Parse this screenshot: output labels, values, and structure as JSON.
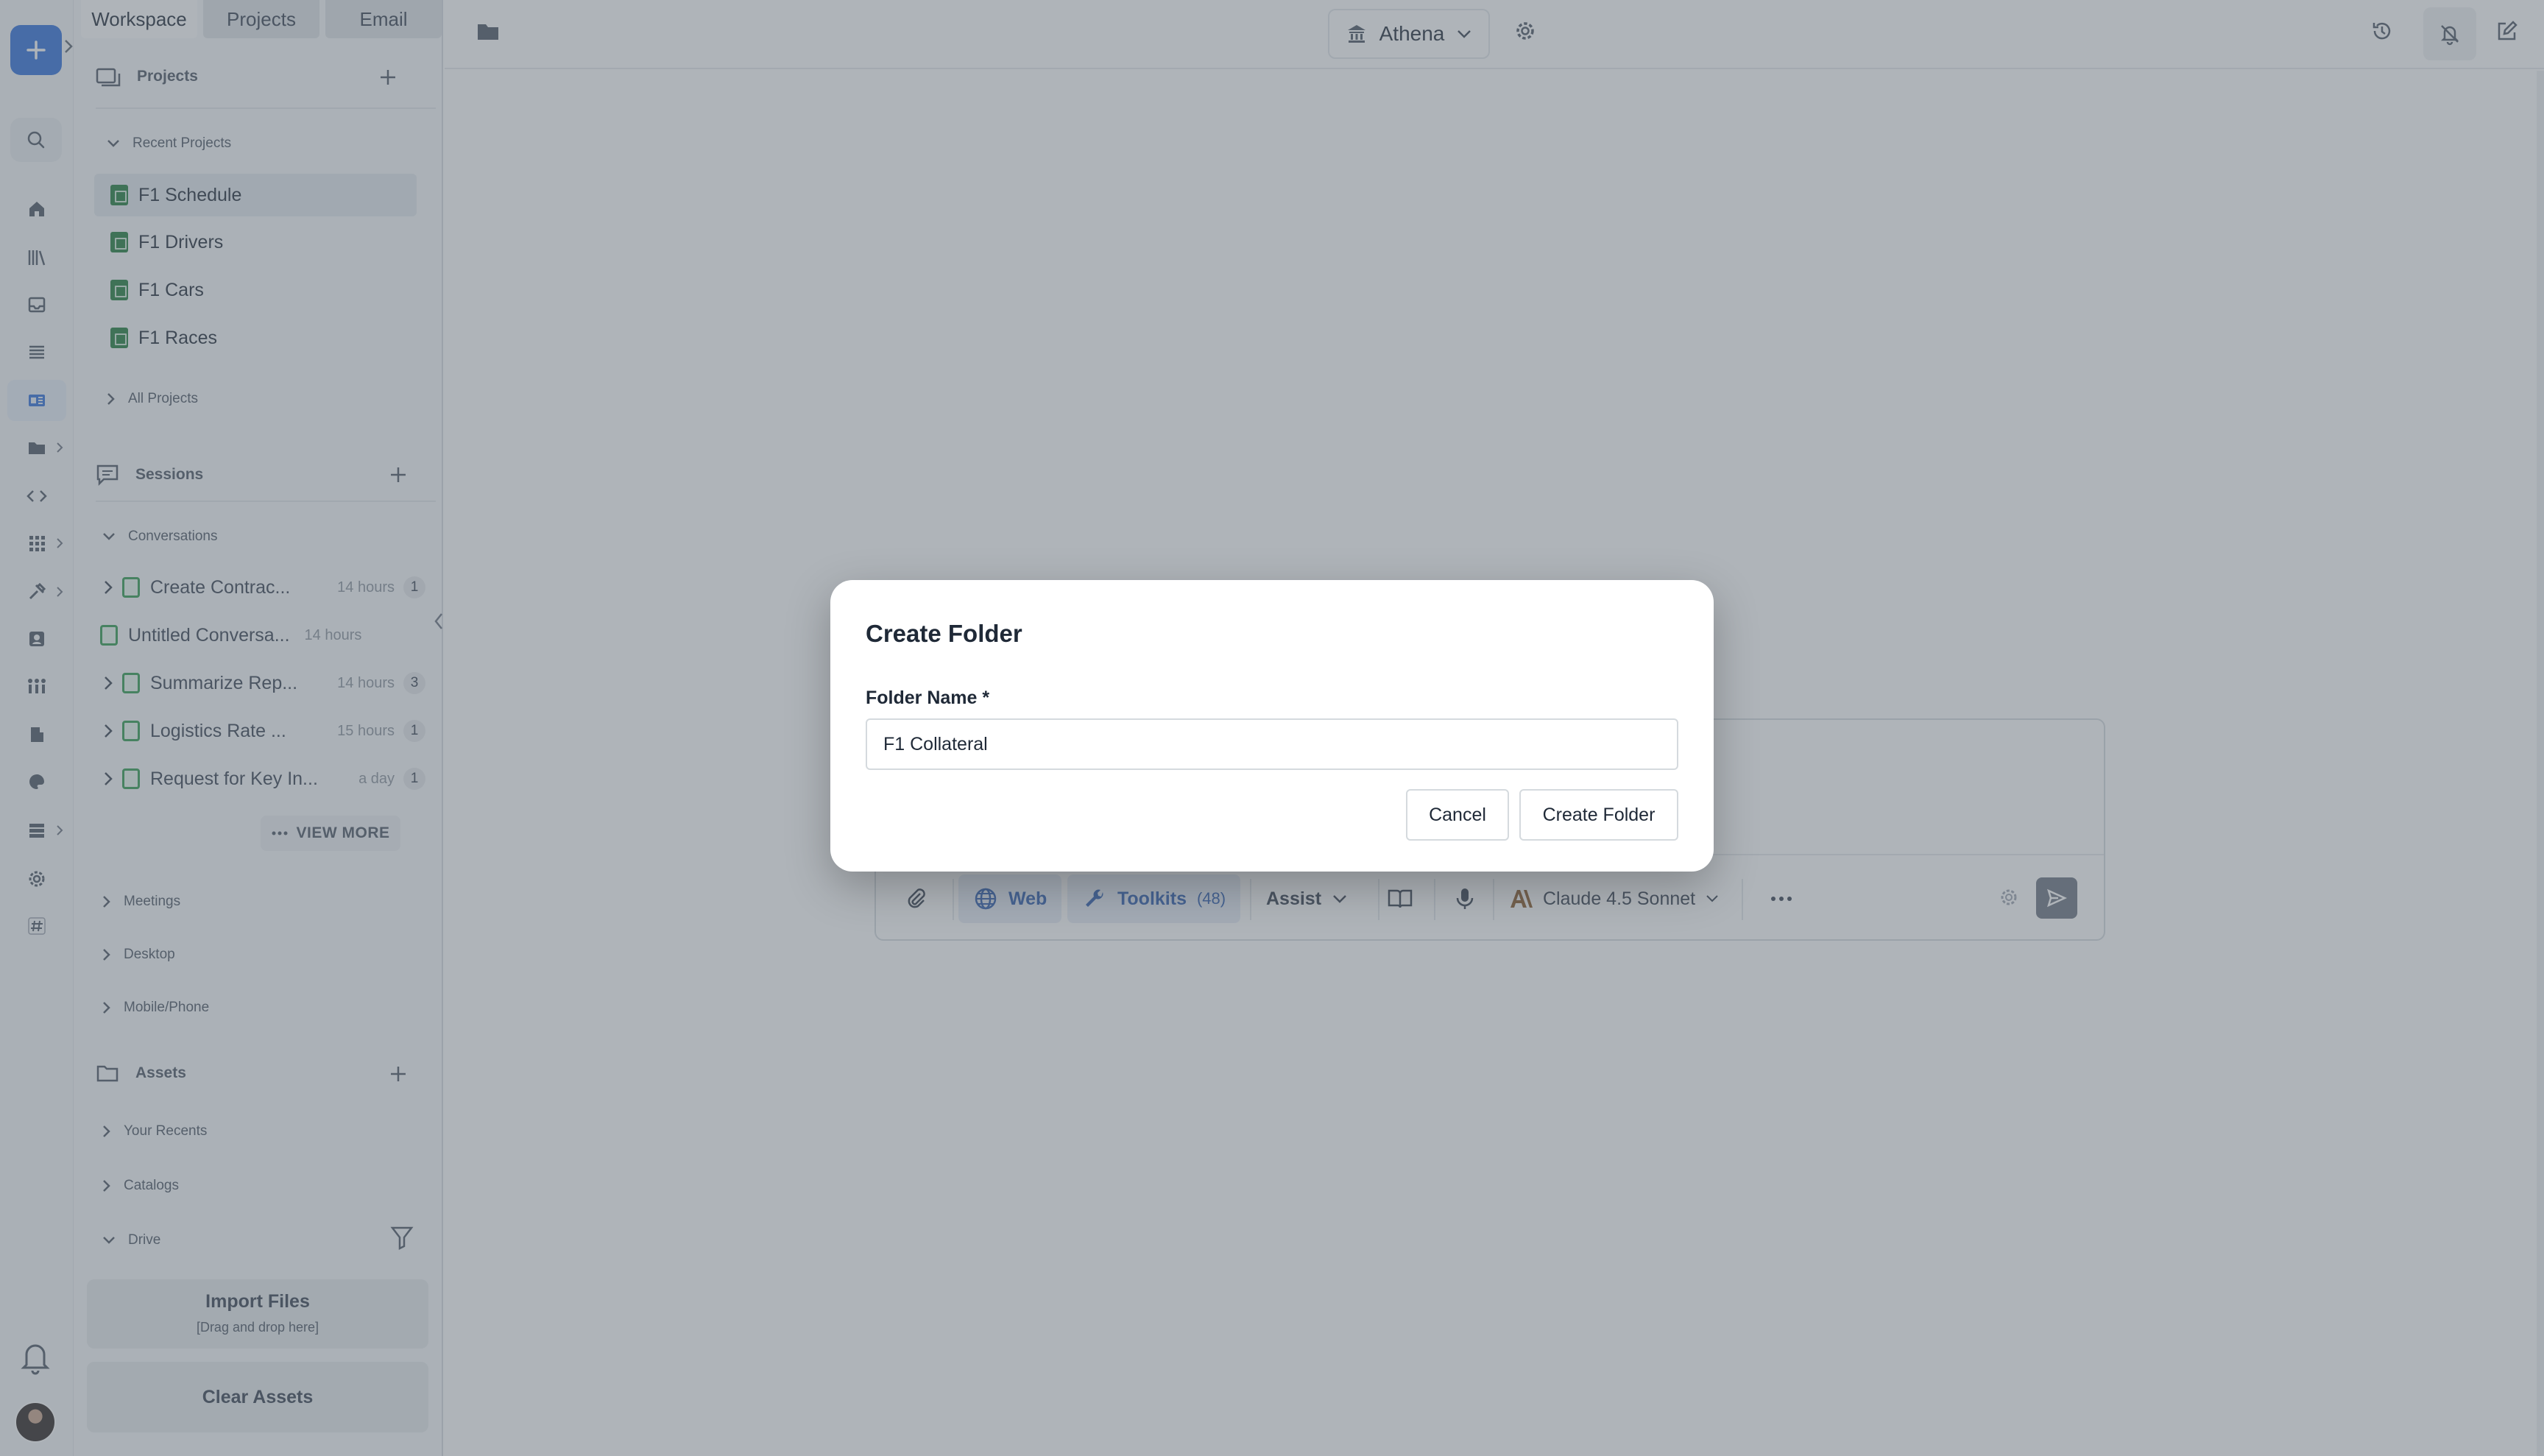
{
  "sidebar": {
    "tabs": [
      {
        "label": "Workspace"
      },
      {
        "label": "Projects"
      },
      {
        "label": "Email"
      }
    ],
    "projects": {
      "heading": "Projects",
      "recent_label": "Recent Projects",
      "items": [
        {
          "label": "F1 Schedule"
        },
        {
          "label": "F1 Drivers"
        },
        {
          "label": "F1 Cars"
        },
        {
          "label": "F1 Races"
        }
      ],
      "all_label": "All Projects"
    },
    "sessions": {
      "heading": "Sessions",
      "conversations_label": "Conversations",
      "items": [
        {
          "title": "Create Contrac...",
          "time": "14 hours",
          "count": "1"
        },
        {
          "title": "Untitled Conversa...",
          "time": "14 hours",
          "count": ""
        },
        {
          "title": "Summarize Rep...",
          "time": "14 hours",
          "count": "3"
        },
        {
          "title": "Logistics Rate ...",
          "time": "15 hours",
          "count": "1"
        },
        {
          "title": "Request for Key In...",
          "time": "a day",
          "count": "1"
        }
      ],
      "view_more": "VIEW MORE",
      "groups": [
        "Meetings",
        "Desktop",
        "Mobile/Phone"
      ]
    },
    "assets": {
      "heading": "Assets",
      "groups": [
        "Your Recents",
        "Catalogs",
        "Drive"
      ],
      "import_title": "Import Files",
      "import_sub": "[Drag and drop here]",
      "clear_label": "Clear Assets"
    }
  },
  "topbar": {
    "workspace": "Athena"
  },
  "composer": {
    "web_label": "Web",
    "toolkits_label": "Toolkits",
    "toolkits_count": "(48)",
    "mode_label": "Assist",
    "model_label": "Claude 4.5 Sonnet"
  },
  "modal": {
    "title": "Create Folder",
    "field_label": "Folder Name *",
    "field_value": "F1 Collateral",
    "cancel_label": "Cancel",
    "submit_label": "Create Folder"
  },
  "colors": {
    "accent": "#2f6fdb",
    "sheet_green": "#1f7a3b",
    "doc_green": "#2e9a4f"
  }
}
